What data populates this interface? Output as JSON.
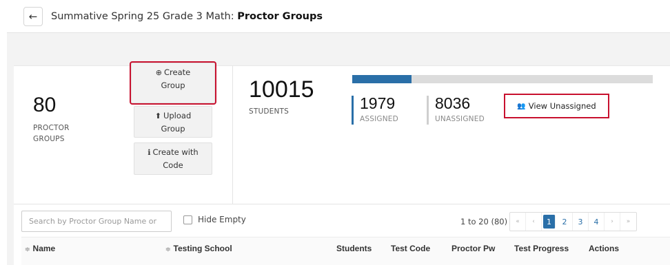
{
  "header": {
    "back_icon": "←",
    "title_prefix": "Summative Spring 25 Grade 3 Math: ",
    "title_bold": "Proctor Groups"
  },
  "groups": {
    "count": "80",
    "label_line1": "PROCTOR",
    "label_line2": "GROUPS"
  },
  "actions": {
    "create_group": {
      "icon": "⊕",
      "line1": "Create",
      "line2": "Group"
    },
    "upload_group": {
      "icon": "⬆",
      "line1": "Upload",
      "line2": "Group"
    },
    "create_with_code": {
      "icon": "ℹ",
      "line1": "Create with",
      "line2": "Code"
    }
  },
  "students": {
    "count": "10015",
    "label": "STUDENTS"
  },
  "progress": {
    "assigned_fraction": 0.198
  },
  "assigned": {
    "count": "1979",
    "label": "ASSIGNED"
  },
  "unassigned": {
    "count": "8036",
    "label": "UNASSIGNED"
  },
  "view_unassigned": {
    "icon": "👥",
    "label": "View Unassigned"
  },
  "search": {
    "placeholder": "Search by Proctor Group Name or"
  },
  "hide_empty": {
    "label": "Hide Empty"
  },
  "pagination": {
    "range": "1 to 20 (80)",
    "first": "«",
    "prev": "‹",
    "pages": [
      "1",
      "2",
      "3",
      "4"
    ],
    "next": "›",
    "last": "»",
    "active_page": "1"
  },
  "table": {
    "columns": [
      "Name",
      "Testing School",
      "Students",
      "Test Code",
      "Proctor Pw",
      "Test Progress",
      "Actions"
    ],
    "sort_icon": "≑"
  },
  "colors": {
    "accent": "#2a6fa8",
    "highlight": "#c8102e"
  }
}
